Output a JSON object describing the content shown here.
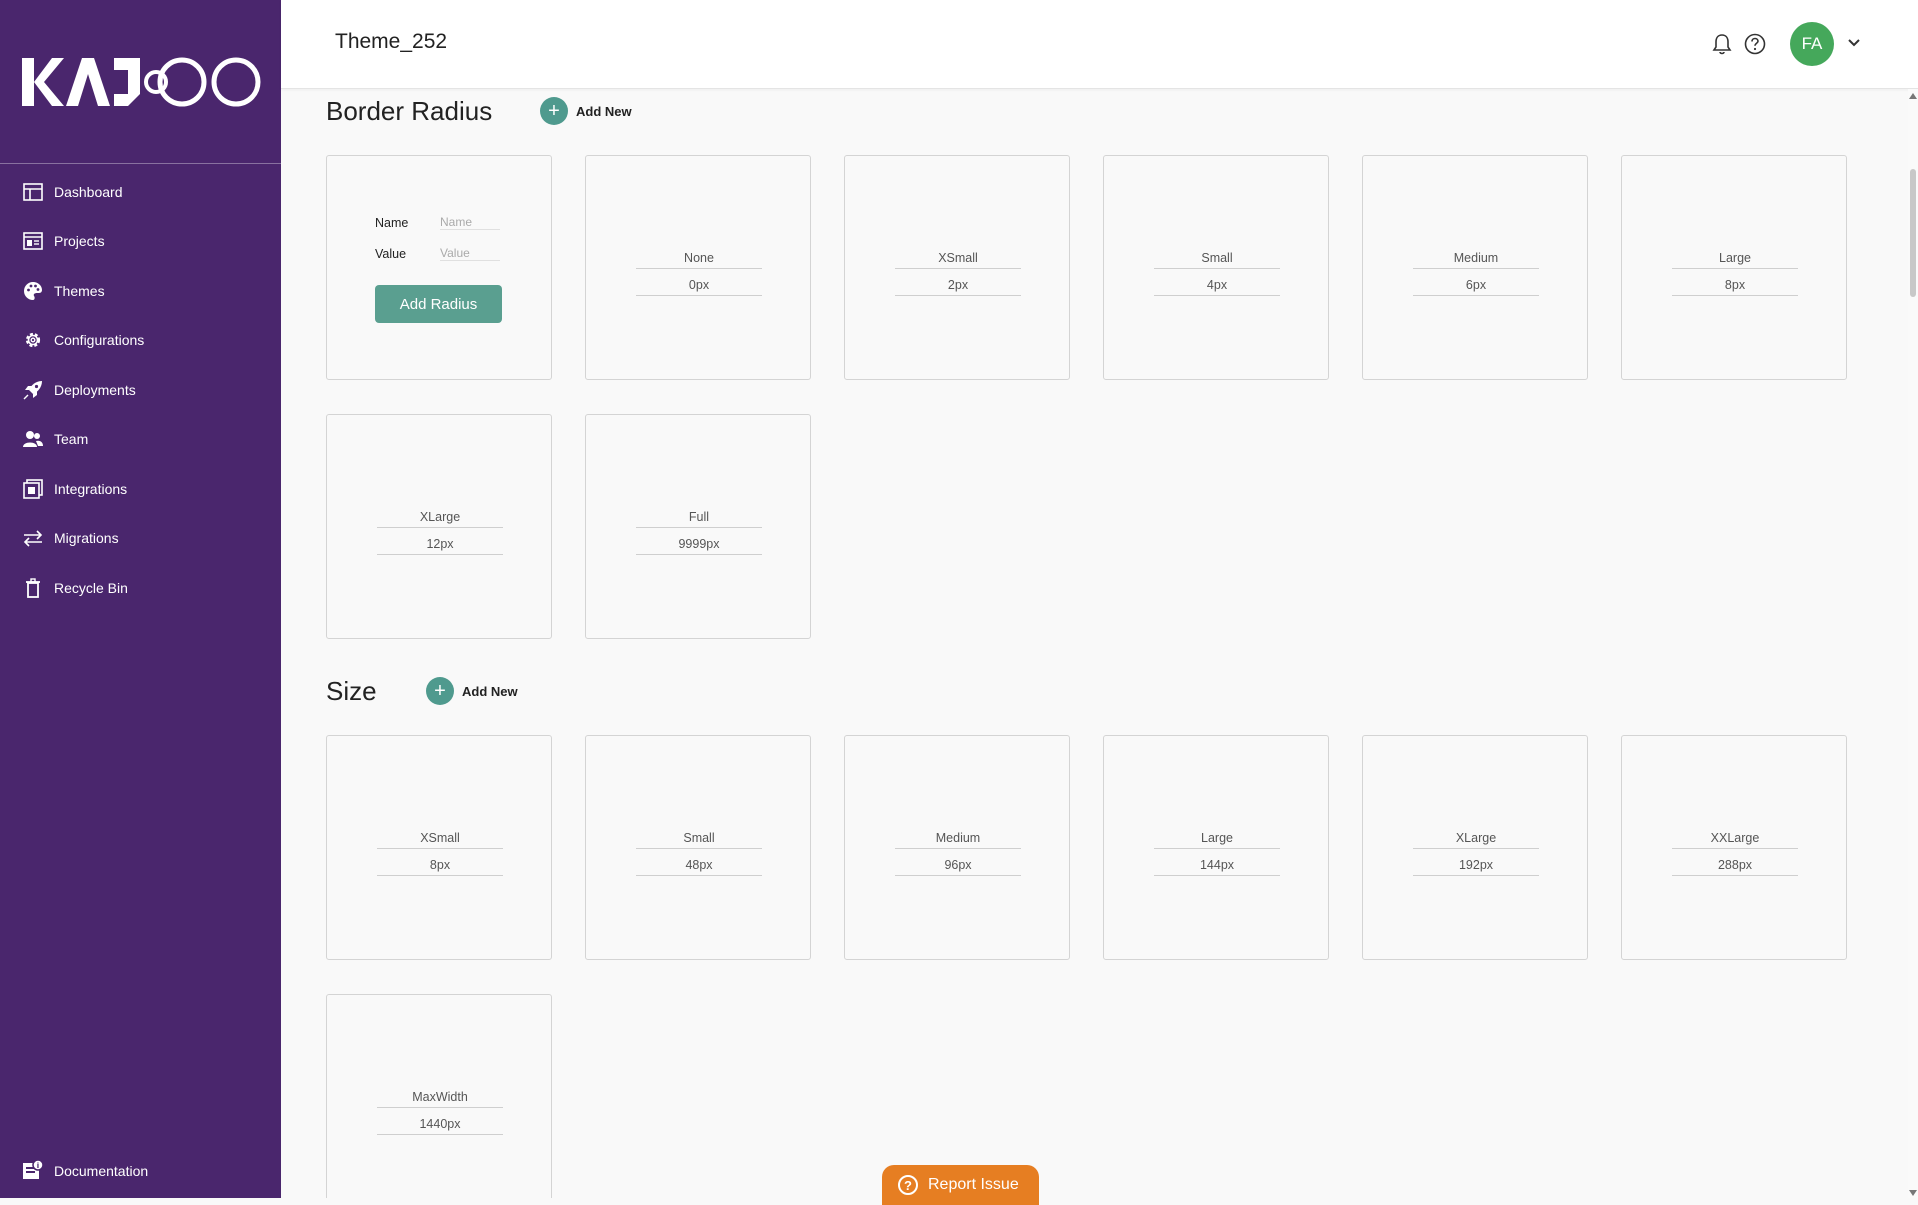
{
  "app": {
    "logo_text": "KAJOO"
  },
  "sidebar": {
    "items": [
      {
        "label": "Dashboard",
        "icon": "dashboard-icon"
      },
      {
        "label": "Projects",
        "icon": "projects-icon"
      },
      {
        "label": "Themes",
        "icon": "palette-icon"
      },
      {
        "label": "Configurations",
        "icon": "gear-icon"
      },
      {
        "label": "Deployments",
        "icon": "rocket-icon"
      },
      {
        "label": "Team",
        "icon": "team-icon"
      },
      {
        "label": "Integrations",
        "icon": "integrations-icon"
      },
      {
        "label": "Migrations",
        "icon": "arrows-icon"
      },
      {
        "label": "Recycle Bin",
        "icon": "trash-icon"
      }
    ],
    "documentation_label": "Documentation"
  },
  "header": {
    "title": "Theme_252",
    "avatar_initials": "FA"
  },
  "border_radius": {
    "title": "Border Radius",
    "add_new_label": "Add New",
    "form": {
      "name_label": "Name",
      "name_placeholder": "Name",
      "value_label": "Value",
      "value_placeholder": "Value",
      "button_label": "Add Radius"
    },
    "items": [
      {
        "name": "None",
        "value": "0px"
      },
      {
        "name": "XSmall",
        "value": "2px"
      },
      {
        "name": "Small",
        "value": "4px"
      },
      {
        "name": "Medium",
        "value": "6px"
      },
      {
        "name": "Large",
        "value": "8px"
      },
      {
        "name": "XLarge",
        "value": "12px"
      },
      {
        "name": "Full",
        "value": "9999px"
      }
    ]
  },
  "size": {
    "title": "Size",
    "add_new_label": "Add New",
    "items": [
      {
        "name": "XSmall",
        "value": "8px"
      },
      {
        "name": "Small",
        "value": "48px"
      },
      {
        "name": "Medium",
        "value": "96px"
      },
      {
        "name": "Large",
        "value": "144px"
      },
      {
        "name": "XLarge",
        "value": "192px"
      },
      {
        "name": "XXLarge",
        "value": "288px"
      },
      {
        "name": "MaxWidth",
        "value": "1440px"
      }
    ]
  },
  "report_issue": {
    "label": "Report Issue"
  },
  "colors": {
    "sidebar": "#4a266d",
    "accent": "#4f9a8e",
    "avatar": "#45a85b",
    "report": "#e67e22"
  }
}
